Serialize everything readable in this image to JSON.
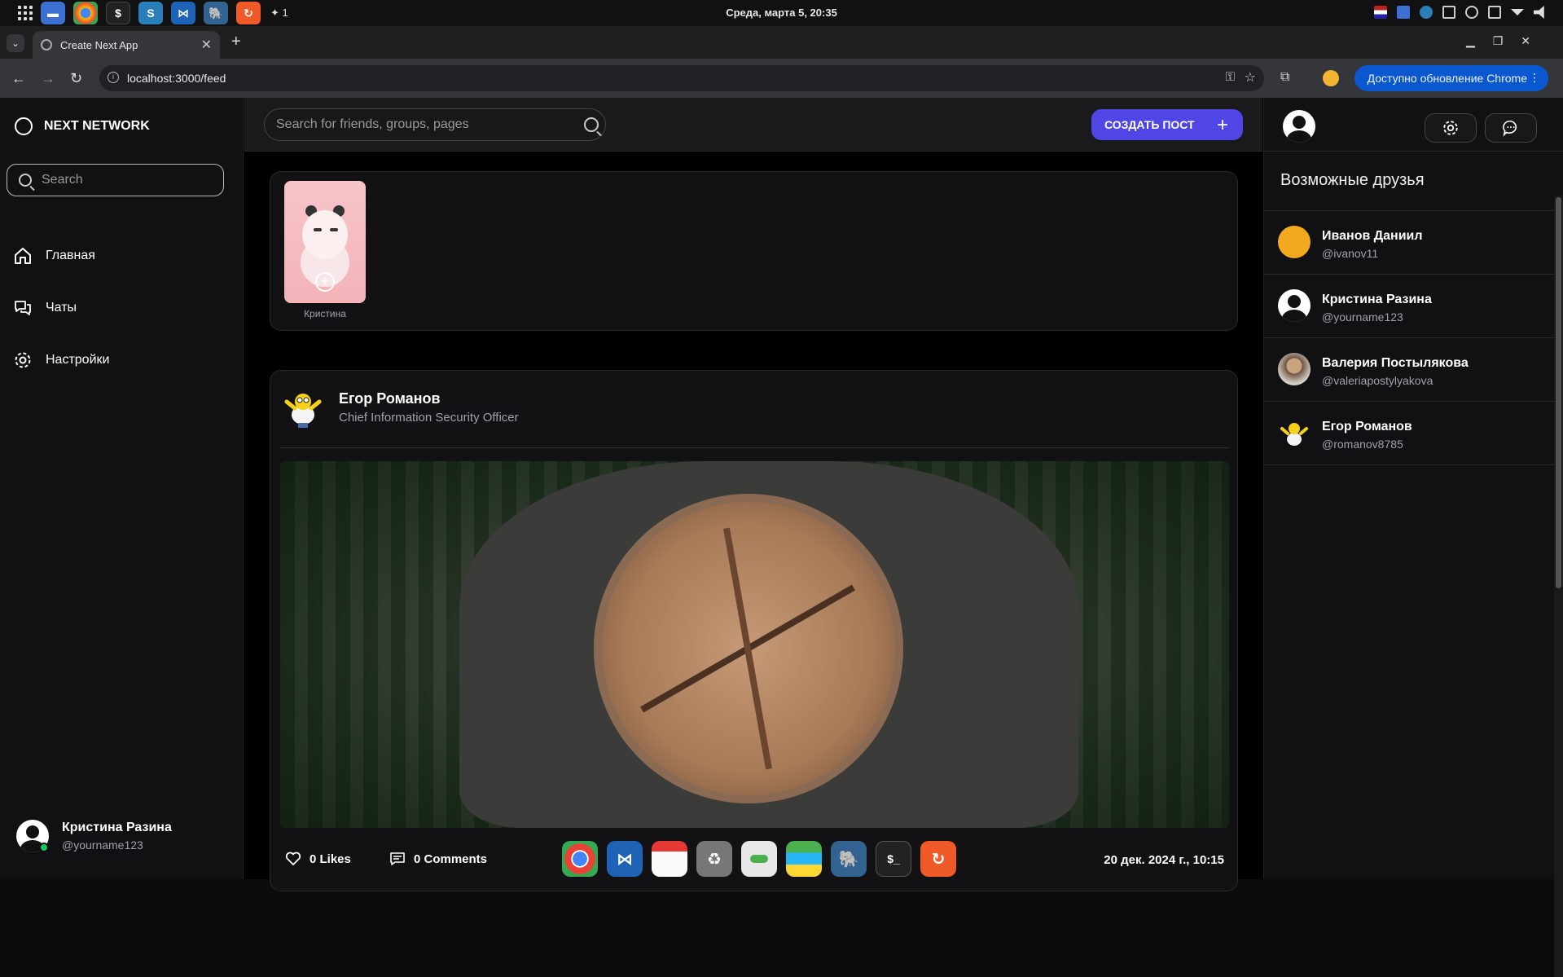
{
  "os": {
    "clock": "Среда, марта  5,  20:35",
    "notification_count": "1",
    "apps": [
      "files",
      "chrome",
      "terminal",
      "shotwell",
      "vscode",
      "postgres",
      "vpn"
    ]
  },
  "browser": {
    "tab_title": "Create Next App",
    "url": "localhost:3000/feed",
    "update_label": "Доступно обновление Chrome"
  },
  "sidebar": {
    "brand": "NEXT NETWORK",
    "search_placeholder": "Search",
    "nav": [
      {
        "label": "Главная",
        "icon": "home-icon"
      },
      {
        "label": "Чаты",
        "icon": "chats-icon"
      },
      {
        "label": "Настройки",
        "icon": "settings-icon"
      }
    ],
    "current_user": {
      "name": "Кристина Разина",
      "handle": "@yourname123",
      "status": "online"
    }
  },
  "header": {
    "search_placeholder": "Search for friends, groups, pages",
    "create_post_label": "СОЗДАТЬ ПОСТ",
    "accent_color": "#4f46e5"
  },
  "stories": [
    {
      "name": "Кристина"
    }
  ],
  "post": {
    "author": "Егор Романов",
    "role": "Chief Information Security Officer",
    "likes": "0 Likes",
    "comments": "0 Comments",
    "date": "20 дек. 2024 г., 10:15"
  },
  "right_panel": {
    "title": "Возможные друзья",
    "friends": [
      {
        "name": "Иванов Даниил",
        "handle": "@ivanov11"
      },
      {
        "name": "Кристина Разина",
        "handle": "@yourname123"
      },
      {
        "name": "Валерия Постылякова",
        "handle": "@valeriapostylyakova"
      },
      {
        "name": "Егор Романов",
        "handle": "@romanov8785"
      }
    ]
  },
  "dock": [
    "chrome",
    "vscode",
    "calendar",
    "trash",
    "settings",
    "stack",
    "postgres",
    "terminal",
    "vpn"
  ]
}
